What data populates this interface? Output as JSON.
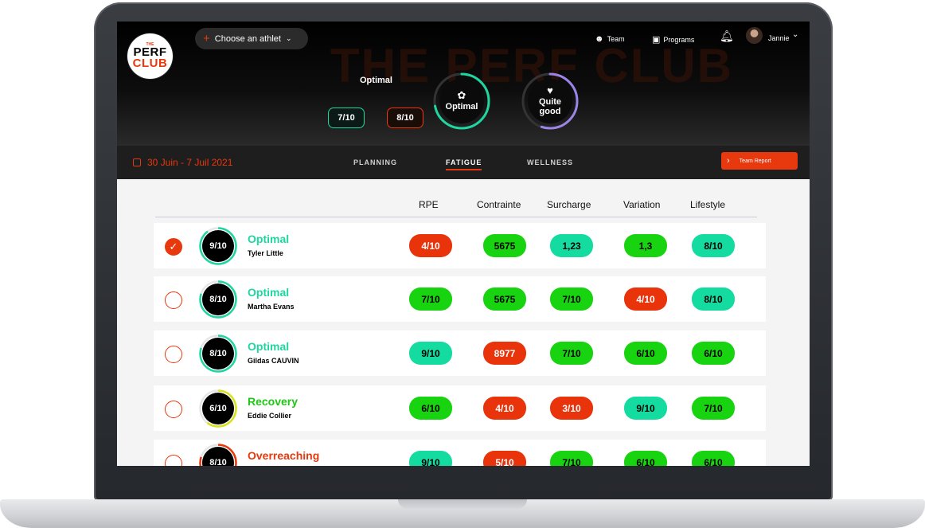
{
  "colors": {
    "accent": "#e8380d",
    "green": "#18d30f",
    "teal": "#14dba0",
    "red": "#e8330b",
    "optimal": "#1fd6a0",
    "recovery": "#1ec714",
    "overreaching": "#e8380d"
  },
  "logo": {
    "line1": "THE",
    "line2": "PERF",
    "line3": "CLUB"
  },
  "header": {
    "athlete_select": "Choose an athlet",
    "watermark": "THE PERF CLUB",
    "nav": [
      {
        "label": "Team",
        "icon": "team-icon"
      },
      {
        "label": "Programs",
        "icon": "calendar-icon"
      }
    ],
    "user_name": "Jannie"
  },
  "summary": {
    "label": "Optimal",
    "box1": "7/10",
    "box2": "8/10",
    "ring1": {
      "label": "Optimal",
      "icon": "run-icon",
      "fill": 0.72
    },
    "ring2": {
      "label": "Quite good",
      "icon": "heart-rate-icon",
      "fill": 0.55
    }
  },
  "subbar": {
    "date_range": "30 Juin - 7 Juil 2021",
    "tabs": [
      "PLANNING",
      "FATIGUE",
      "WELLNESS"
    ],
    "active_tab": "FATIGUE",
    "team_report": "Team Report"
  },
  "table": {
    "columns": [
      "RPE",
      "Contrainte",
      "Surcharge",
      "Variation",
      "Lifestyle"
    ],
    "rows": [
      {
        "selected": true,
        "score": "9/10",
        "score_fill": 0.9,
        "ring_color": "#1fd6a0",
        "status": "Optimal",
        "status_color": "#1fd6a0",
        "name": "Tyler Little",
        "values": [
          {
            "text": "4/10",
            "color": "#e8330b",
            "text_color": "#ffffff"
          },
          {
            "text": "5675",
            "color": "#18d30f",
            "text_color": "#000000"
          },
          {
            "text": "1,23",
            "color": "#14dba0",
            "text_color": "#000000"
          },
          {
            "text": "1,3",
            "color": "#18d30f",
            "text_color": "#000000"
          },
          {
            "text": "8/10",
            "color": "#14dba0",
            "text_color": "#000000"
          }
        ]
      },
      {
        "selected": false,
        "score": "8/10",
        "score_fill": 0.8,
        "ring_color": "#1fd6a0",
        "status": "Optimal",
        "status_color": "#1fd6a0",
        "name": "Martha Evans",
        "values": [
          {
            "text": "7/10",
            "color": "#18d30f",
            "text_color": "#000000"
          },
          {
            "text": "5675",
            "color": "#18d30f",
            "text_color": "#000000"
          },
          {
            "text": "7/10",
            "color": "#18d30f",
            "text_color": "#000000"
          },
          {
            "text": "4/10",
            "color": "#e8330b",
            "text_color": "#ffffff"
          },
          {
            "text": "8/10",
            "color": "#14dba0",
            "text_color": "#000000"
          }
        ]
      },
      {
        "selected": false,
        "score": "8/10",
        "score_fill": 0.8,
        "ring_color": "#1fd6a0",
        "status": "Optimal",
        "status_color": "#1fd6a0",
        "name": "Gildas CAUVIN",
        "values": [
          {
            "text": "9/10",
            "color": "#14dba0",
            "text_color": "#000000"
          },
          {
            "text": "8977",
            "color": "#e8330b",
            "text_color": "#ffffff"
          },
          {
            "text": "7/10",
            "color": "#18d30f",
            "text_color": "#000000"
          },
          {
            "text": "6/10",
            "color": "#18d30f",
            "text_color": "#000000"
          },
          {
            "text": "6/10",
            "color": "#18d30f",
            "text_color": "#000000"
          }
        ]
      },
      {
        "selected": false,
        "score": "6/10",
        "score_fill": 0.6,
        "ring_color": "#d8e11a",
        "status": "Recovery",
        "status_color": "#1ec714",
        "name": "Eddie Collier",
        "values": [
          {
            "text": "6/10",
            "color": "#18d30f",
            "text_color": "#000000"
          },
          {
            "text": "4/10",
            "color": "#e8330b",
            "text_color": "#ffffff"
          },
          {
            "text": "3/10",
            "color": "#e8330b",
            "text_color": "#ffffff"
          },
          {
            "text": "9/10",
            "color": "#14dba0",
            "text_color": "#000000"
          },
          {
            "text": "7/10",
            "color": "#18d30f",
            "text_color": "#000000"
          }
        ]
      },
      {
        "selected": false,
        "score": "8/10",
        "score_fill": 0.8,
        "ring_color": "#e8380d",
        "status": "Overreaching",
        "status_color": "#e8380d",
        "name": "",
        "values": [
          {
            "text": "9/10",
            "color": "#14dba0",
            "text_color": "#000000"
          },
          {
            "text": "5/10",
            "color": "#e8330b",
            "text_color": "#ffffff"
          },
          {
            "text": "7/10",
            "color": "#18d30f",
            "text_color": "#000000"
          },
          {
            "text": "6/10",
            "color": "#18d30f",
            "text_color": "#000000"
          },
          {
            "text": "6/10",
            "color": "#18d30f",
            "text_color": "#000000"
          }
        ]
      }
    ]
  }
}
